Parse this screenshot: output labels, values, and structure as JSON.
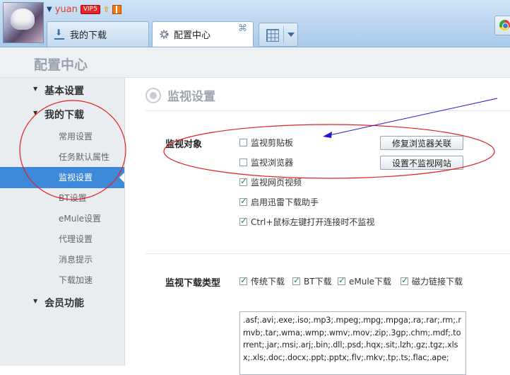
{
  "header": {
    "username": "yuan",
    "vip_badge": "VIP5",
    "tabs": [
      {
        "label": "我的下载",
        "icon": "download-icon"
      },
      {
        "label": "配置中心",
        "icon": "gear-icon",
        "close": "⌘"
      }
    ]
  },
  "page": {
    "title": "配置中心"
  },
  "sidebar": {
    "groups": [
      {
        "label": "基本设置"
      },
      {
        "label": "我的下载",
        "items": [
          "常用设置",
          "任务默认属性",
          "监视设置",
          "BT设置",
          "eMule设置",
          "代理设置",
          "消息提示",
          "下载加速"
        ]
      },
      {
        "label": "会员功能"
      }
    ],
    "active_item": "监视设置"
  },
  "main": {
    "section_title": "监视设置",
    "monitor_objects": {
      "label": "监视对象",
      "options": [
        {
          "label": "监视剪贴板",
          "checked": false
        },
        {
          "label": "监视浏览器",
          "checked": false
        },
        {
          "label": "监视网页视频",
          "checked": true
        },
        {
          "label": "启用迅雷下载助手",
          "checked": true
        },
        {
          "label": "Ctrl+鼠标左键打开连接时不监视",
          "checked": true
        }
      ],
      "buttons": [
        "修复浏览器关联",
        "设置不监视网站"
      ]
    },
    "monitor_types": {
      "label": "监视下载类型",
      "options": [
        {
          "label": "传统下载",
          "checked": true
        },
        {
          "label": "BT下载",
          "checked": true
        },
        {
          "label": "eMule下载",
          "checked": true
        },
        {
          "label": "磁力链接下载",
          "checked": true
        }
      ],
      "extensions": ".asf;.avi;.exe;.iso;.mp3;.mpeg;.mpg;.mpga;.ra;.rar;.rm;.rmvb;.tar;.wma;.wmp;.wmv;.mov;.zip;.3gp;.chm;.mdf;.torrent;.jar;.msi;.arj;.bin;.dll;.psd;.hqx;.sit;.lzh;.gz;.tgz;.xlsx;.xls;.doc;.docx;.ppt;.pptx;.flv;.mkv;.tp;.ts;.flac;.ape;"
    }
  },
  "colors": {
    "accent": "#3f8ad8",
    "annotation_red": "#e02020",
    "annotation_blue": "#1a1ad0"
  }
}
